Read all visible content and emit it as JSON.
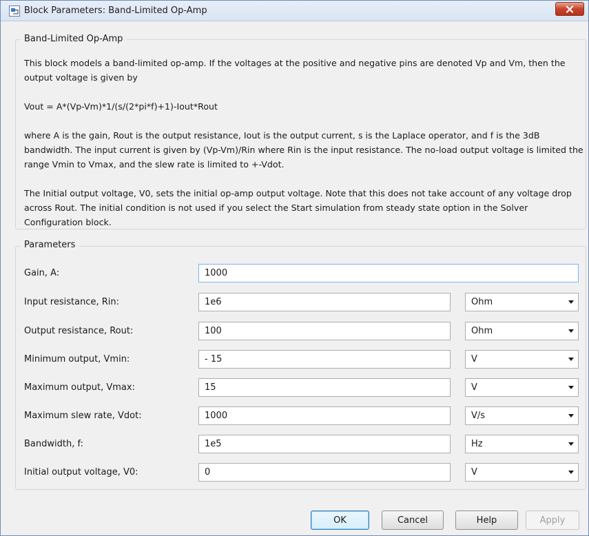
{
  "window": {
    "title": "Block Parameters: Band-Limited Op-Amp",
    "app_icon": "simulink-block-icon",
    "close_icon": "close-icon",
    "close_color": "#c7442c"
  },
  "description": {
    "legend": "Band-Limited Op-Amp",
    "paragraphs": [
      "This block models a band-limited op-amp. If the voltages at the positive and negative pins are denoted Vp and Vm, then the output voltage is given by",
      "Vout = A*(Vp-Vm)*1/(s/(2*pi*f)+1)-Iout*Rout",
      "where A is the gain, Rout is the output resistance, Iout is the output current, s is the Laplace operator, and f is the 3dB bandwidth. The input current is given by (Vp-Vm)/Rin where Rin is the input resistance. The no-load output voltage is limited the range Vmin to Vmax, and the slew rate is limited to +-Vdot.",
      "The Initial output voltage, V0, sets the initial op-amp output voltage. Note that this does not take account of any voltage drop across Rout. The initial condition is not used if you select the Start simulation from steady state option in the Solver Configuration block."
    ]
  },
  "parameters": {
    "legend": "Parameters",
    "rows": [
      {
        "label": "Gain, A:",
        "value": "1000",
        "unit": ""
      },
      {
        "label": "Input resistance, Rin:",
        "value": "1e6",
        "unit": "Ohm"
      },
      {
        "label": "Output resistance, Rout:",
        "value": "100",
        "unit": "Ohm"
      },
      {
        "label": "Minimum output, Vmin:",
        "value": "- 15",
        "unit": "V"
      },
      {
        "label": "Maximum output, Vmax:",
        "value": "15",
        "unit": "V"
      },
      {
        "label": "Maximum slew rate, Vdot:",
        "value": "1000",
        "unit": "V/s"
      },
      {
        "label": "Bandwidth, f:",
        "value": "1e5",
        "unit": "Hz"
      },
      {
        "label": "Initial output voltage, V0:",
        "value": "0",
        "unit": "V"
      }
    ],
    "dropdown_icon": "chevron-down-icon"
  },
  "buttons": {
    "ok": "OK",
    "cancel": "Cancel",
    "help": "Help",
    "apply": "Apply",
    "apply_enabled": false
  }
}
